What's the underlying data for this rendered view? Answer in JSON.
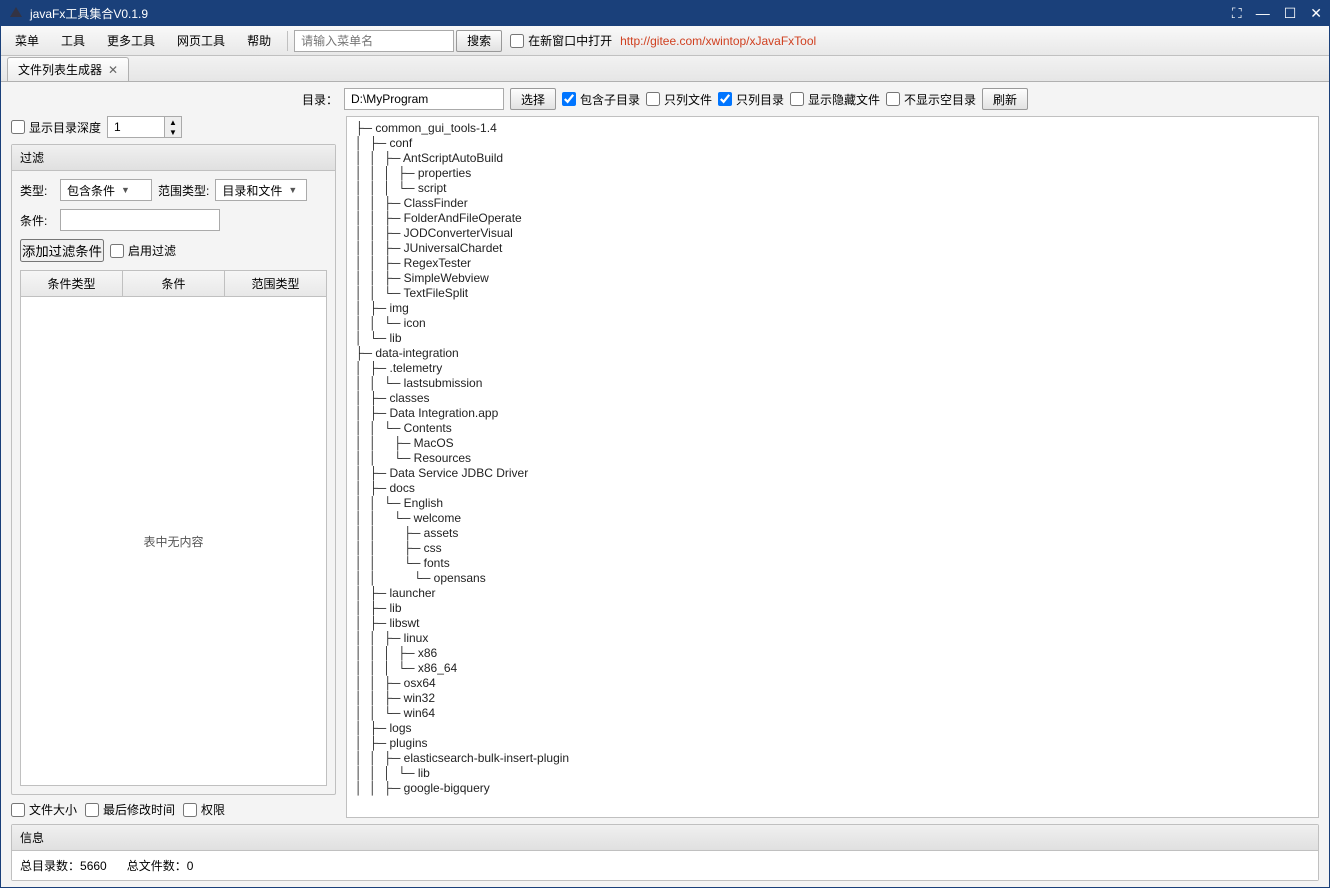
{
  "window": {
    "title": "javaFx工具集合V0.1.9"
  },
  "menubar": {
    "items": [
      "菜单",
      "工具",
      "更多工具",
      "网页工具",
      "帮助"
    ],
    "search_placeholder": "请输入菜单名",
    "search_btn": "搜索",
    "newwin_chk": "在新窗口中打开",
    "link": "http://gitee.com/xwintop/xJavaFxTool"
  },
  "tab": {
    "label": "文件列表生成器"
  },
  "topbar": {
    "dir_label": "目录：",
    "dir_value": "D:\\MyProgram",
    "choose_btn": "选择",
    "include_sub": "包含子目录",
    "only_files": "只列文件",
    "only_dirs": "只列目录",
    "show_hidden": "显示隐藏文件",
    "no_empty_dir": "不显示空目录",
    "refresh_btn": "刷新"
  },
  "left": {
    "show_depth": "显示目录深度",
    "depth_value": "1",
    "filter_hdr": "过滤",
    "type_label": "类型:",
    "type_value": "包含条件",
    "scope_type_label": "范围类型:",
    "scope_type_value": "目录和文件",
    "cond_label": "条件:",
    "add_filter_btn": "添加过滤条件",
    "enable_filter": "启用过滤",
    "th1": "条件类型",
    "th2": "条件",
    "th3": "范围类型",
    "empty_table": "表中无内容",
    "chk_size": "文件大小",
    "chk_mtime": "最后修改时间",
    "chk_perm": "权限"
  },
  "tree_lines": [
    "├─ common_gui_tools-1.4",
    "│  ├─ conf",
    "│  │  ├─ AntScriptAutoBuild",
    "│  │  │  ├─ properties",
    "│  │  │  └─ script",
    "│  │  ├─ ClassFinder",
    "│  │  ├─ FolderAndFileOperate",
    "│  │  ├─ JODConverterVisual",
    "│  │  ├─ JUniversalChardet",
    "│  │  ├─ RegexTester",
    "│  │  ├─ SimpleWebview",
    "│  │  └─ TextFileSplit",
    "│  ├─ img",
    "│  │  └─ icon",
    "│  └─ lib",
    "├─ data-integration",
    "│  ├─ .telemetry",
    "│  │  └─ lastsubmission",
    "│  ├─ classes",
    "│  ├─ Data Integration.app",
    "│  │  └─ Contents",
    "│  │     ├─ MacOS",
    "│  │     └─ Resources",
    "│  ├─ Data Service JDBC Driver",
    "│  ├─ docs",
    "│  │  └─ English",
    "│  │     └─ welcome",
    "│  │        ├─ assets",
    "│  │        ├─ css",
    "│  │        └─ fonts",
    "│  │           └─ opensans",
    "│  ├─ launcher",
    "│  ├─ lib",
    "│  ├─ libswt",
    "│  │  ├─ linux",
    "│  │  │  ├─ x86",
    "│  │  │  └─ x86_64",
    "│  │  ├─ osx64",
    "│  │  ├─ win32",
    "│  │  └─ win64",
    "│  ├─ logs",
    "│  ├─ plugins",
    "│  │  ├─ elasticsearch-bulk-insert-plugin",
    "│  │  │  └─ lib",
    "│  │  ├─ google-bigquery"
  ],
  "info": {
    "hdr": "信息",
    "total_dirs_label": "总目录数：",
    "total_dirs_val": "5660",
    "total_files_label": "总文件数：",
    "total_files_val": "0"
  }
}
